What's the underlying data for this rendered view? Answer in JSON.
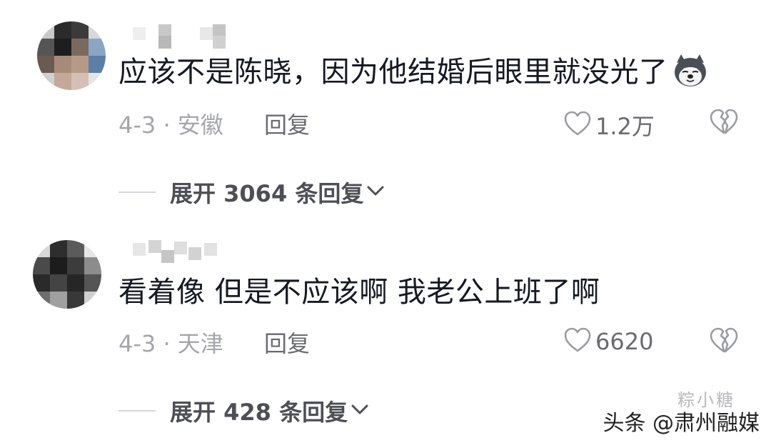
{
  "comments": [
    {
      "text": "应该不是陈晓，因为他结婚后眼里就没光了",
      "emoji": "husky-dog-icon",
      "date_location": "4-3 · 安徽",
      "reply_label": "回复",
      "likes": "1.2万",
      "expand_label": "展开 3064 条回复"
    },
    {
      "text": "看着像 但是不应该啊 我老公上班了啊",
      "date_location": "4-3 · 天津",
      "reply_label": "回复",
      "likes": "6620",
      "expand_label": "展开 428 条回复"
    }
  ],
  "watermark": {
    "text": "头条 @肃州融媒",
    "faint_text": "粽小糖"
  },
  "icons": {
    "like": "heart-outline-icon",
    "dislike": "broken-heart-icon",
    "expand": "chevron-down-icon"
  },
  "colors": {
    "text_primary": "#161823",
    "text_meta": "#a5a6ab",
    "text_secondary": "#6a6b70",
    "divider": "#d6d7da"
  }
}
